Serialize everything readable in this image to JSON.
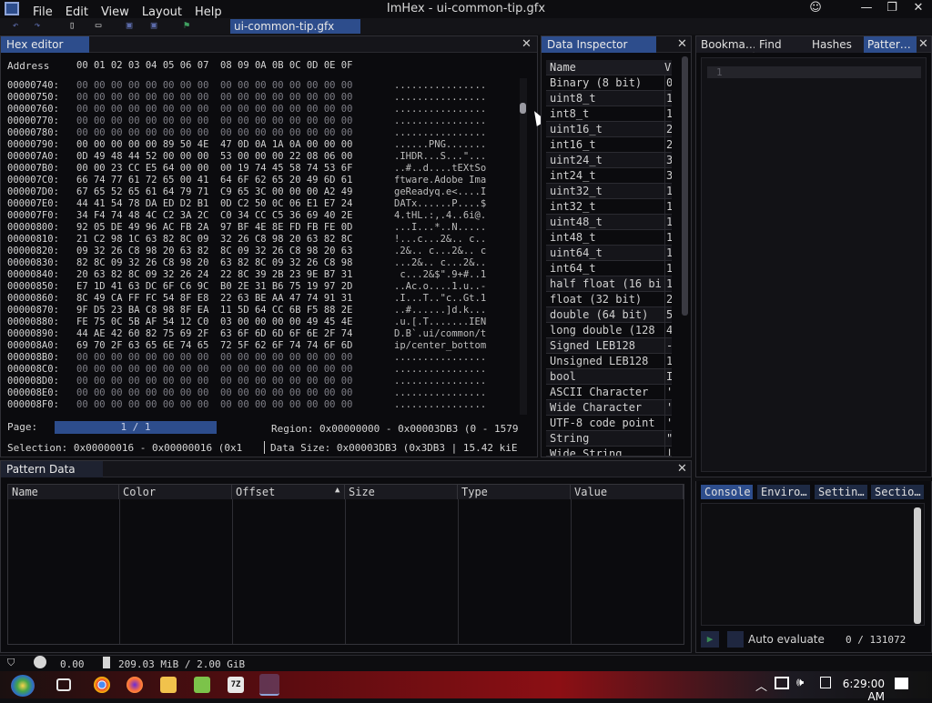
{
  "window": {
    "title": "ImHex - ui-common-tip.gfx",
    "menus": [
      "File",
      "Edit",
      "View",
      "Layout",
      "Help"
    ],
    "file_tab": "ui-common-tip.gfx"
  },
  "hex_editor": {
    "tab": "Hex editor",
    "header_address": "Address",
    "header_bytes": "00 01 02 03 04 05 06 07  08 09 0A 0B 0C 0D 0E 0F",
    "rows": [
      {
        "addr": "00000740:",
        "bytes": "00 00 00 00 00 00 00 00  00 00 00 00 00 00 00 00",
        "ascii": "................",
        "zero": true
      },
      {
        "addr": "00000750:",
        "bytes": "00 00 00 00 00 00 00 00  00 00 00 00 00 00 00 00",
        "ascii": "................",
        "zero": true
      },
      {
        "addr": "00000760:",
        "bytes": "00 00 00 00 00 00 00 00  00 00 00 00 00 00 00 00",
        "ascii": "................",
        "zero": true
      },
      {
        "addr": "00000770:",
        "bytes": "00 00 00 00 00 00 00 00  00 00 00 00 00 00 00 00",
        "ascii": "................",
        "zero": true
      },
      {
        "addr": "00000780:",
        "bytes": "00 00 00 00 00 00 00 00  00 00 00 00 00 00 00 00",
        "ascii": "................",
        "zero": true
      },
      {
        "addr": "00000790:",
        "bytes": "00 00 00 00 00 89 50 4E  47 0D 0A 1A 0A 00 00 00",
        "ascii": "......PNG.......",
        "zero": false
      },
      {
        "addr": "000007A0:",
        "bytes": "0D 49 48 44 52 00 00 00  53 00 00 00 22 08 06 00",
        "ascii": ".IHDR...S...\"...",
        "zero": false
      },
      {
        "addr": "000007B0:",
        "bytes": "00 00 23 CC E5 64 00 00  00 19 74 45 58 74 53 6F",
        "ascii": "..#..d....tEXtSo",
        "zero": false
      },
      {
        "addr": "000007C0:",
        "bytes": "66 74 77 61 72 65 00 41  64 6F 62 65 20 49 6D 61",
        "ascii": "ftware.Adobe Ima",
        "zero": false
      },
      {
        "addr": "000007D0:",
        "bytes": "67 65 52 65 61 64 79 71  C9 65 3C 00 00 00 A2 49",
        "ascii": "geReadyq.e<....I",
        "zero": false
      },
      {
        "addr": "000007E0:",
        "bytes": "44 41 54 78 DA ED D2 B1  0D C2 50 0C 06 E1 E7 24",
        "ascii": "DATx......P....$",
        "zero": false
      },
      {
        "addr": "000007F0:",
        "bytes": "34 F4 74 48 4C C2 3A 2C  C0 34 CC C5 36 69 40 2E",
        "ascii": "4.tHL.:,.4..6i@.",
        "zero": false
      },
      {
        "addr": "00000800:",
        "bytes": "92 05 DE 49 96 AC FB 2A  97 BF 4E 8E FD FB FE 0D",
        "ascii": "...I...*..N.....",
        "zero": false
      },
      {
        "addr": "00000810:",
        "bytes": "21 C2 98 1C 63 82 8C 09  32 26 C8 98 20 63 82 8C",
        "ascii": "!...c...2&.. c..",
        "zero": false
      },
      {
        "addr": "00000820:",
        "bytes": "09 32 26 C8 98 20 63 82  8C 09 32 26 C8 98 20 63",
        "ascii": ".2&.. c...2&.. c",
        "zero": false
      },
      {
        "addr": "00000830:",
        "bytes": "82 8C 09 32 26 C8 98 20  63 82 8C 09 32 26 C8 98",
        "ascii": "...2&.. c...2&..",
        "zero": false
      },
      {
        "addr": "00000840:",
        "bytes": "20 63 82 8C 09 32 26 24  22 8C 39 2B 23 9E B7 31",
        " ascii": "",
        "ascii": " c...2&$\".9+#..1",
        "zero": false
      },
      {
        "addr": "00000850:",
        "bytes": "E7 1D 41 63 DC 6F C6 9C  B0 2E 31 B6 75 19 97 2D",
        "ascii": "..Ac.o....1.u..-",
        "zero": false
      },
      {
        "addr": "00000860:",
        "bytes": "8C 49 CA FF FC 54 8F E8  22 63 BE AA 47 74 91 31",
        "ascii": ".I...T..\"c..Gt.1",
        "zero": false
      },
      {
        "addr": "00000870:",
        "bytes": "9F D5 23 BA C8 98 8F EA  11 5D 64 CC 6B F5 88 2E",
        "ascii": "..#......]d.k...",
        "zero": false
      },
      {
        "addr": "00000880:",
        "bytes": "FE 75 0C 5B AF 54 12 C0  03 00 00 00 00 49 45 4E",
        "ascii": ".u.[.T.......IEN",
        "zero": false
      },
      {
        "addr": "00000890:",
        "bytes": "44 AE 42 60 82 75 69 2F  63 6F 6D 6D 6F 6E 2F 74",
        "ascii": "D.B`.ui/common/t",
        "zero": false
      },
      {
        "addr": "000008A0:",
        "bytes": "69 70 2F 63 65 6E 74 65  72 5F 62 6F 74 74 6F 6D",
        "ascii": "ip/center_bottom",
        "zero": false
      },
      {
        "addr": "000008B0:",
        "bytes": "00 00 00 00 00 00 00 00  00 00 00 00 00 00 00 00",
        "ascii": "................",
        "zero": true
      },
      {
        "addr": "000008C0:",
        "bytes": "00 00 00 00 00 00 00 00  00 00 00 00 00 00 00 00",
        "ascii": "................",
        "zero": true
      },
      {
        "addr": "000008D0:",
        "bytes": "00 00 00 00 00 00 00 00  00 00 00 00 00 00 00 00",
        "ascii": "................",
        "zero": true
      },
      {
        "addr": "000008E0:",
        "bytes": "00 00 00 00 00 00 00 00  00 00 00 00 00 00 00 00",
        "ascii": "................",
        "zero": true
      },
      {
        "addr": "000008F0:",
        "bytes": "00 00 00 00 00 00 00 00  00 00 00 00 00 00 00 00",
        "ascii": "................",
        "zero": true
      }
    ],
    "page_label": "Page:",
    "page_value": "1 / 1",
    "region": "Region: 0x00000000 - 0x00003DB3 (0 - 1579",
    "selection": "Selection: 0x00000016 - 0x00000016 (0x1",
    "data_size": "Data Size: 0x00003DB3 (0x3DB3 | 15.42 kiE"
  },
  "data_inspector": {
    "tab": "Data Inspector",
    "col_name": "Name",
    "col_value": "V",
    "rows": [
      {
        "name": "Binary (8 bit)",
        "value": "0"
      },
      {
        "name": "uint8_t",
        "value": "1"
      },
      {
        "name": "int8_t",
        "value": "1"
      },
      {
        "name": "uint16_t",
        "value": "2"
      },
      {
        "name": "int16_t",
        "value": "2"
      },
      {
        "name": "uint24_t",
        "value": "3"
      },
      {
        "name": "int24_t",
        "value": "3"
      },
      {
        "name": "uint32_t",
        "value": "1"
      },
      {
        "name": "int32_t",
        "value": "1"
      },
      {
        "name": "uint48_t",
        "value": "1"
      },
      {
        "name": "int48_t",
        "value": "1"
      },
      {
        "name": "uint64_t",
        "value": "1"
      },
      {
        "name": "int64_t",
        "value": "1"
      },
      {
        "name": "half float (16 bi",
        "value": "1"
      },
      {
        "name": "float (32 bit)",
        "value": "2"
      },
      {
        "name": "double (64 bit)",
        "value": "5"
      },
      {
        "name": "long double (128 |",
        "value": "4"
      },
      {
        "name": "Signed LEB128",
        "value": "-"
      },
      {
        "name": "Unsigned LEB128",
        "value": "1"
      },
      {
        "name": "bool",
        "value": "I"
      },
      {
        "name": "ASCII Character",
        "value": "'"
      },
      {
        "name": "Wide Character",
        "value": "'"
      },
      {
        "name": "UTF-8 code point",
        "value": "'"
      },
      {
        "name": "String",
        "value": "\""
      },
      {
        "name": "Wide String",
        "value": "|"
      }
    ]
  },
  "right_tabs": [
    "Bookma…",
    "Find",
    "Hashes",
    "Patter…"
  ],
  "pattern_editor": {
    "line_number": "1"
  },
  "pattern_data": {
    "tab": "Pattern Data",
    "columns": [
      "Name",
      "Color",
      "Offset",
      "Size",
      "Type",
      "Value"
    ]
  },
  "console": {
    "tabs": [
      "Console",
      "Enviro…",
      "Settin…",
      "Sectio…"
    ],
    "auto_evaluate": "Auto evaluate",
    "counter": "0 / 131072"
  },
  "statusbar": {
    "fps": "0.00",
    "memory": "209.03 MiB / 2.00 GiB"
  },
  "taskbar": {
    "clock": "6:29:00 AM"
  },
  "colors": {
    "accent": "#2d4d8c",
    "panel_bg": "#0b0b0e",
    "border": "#303036"
  }
}
